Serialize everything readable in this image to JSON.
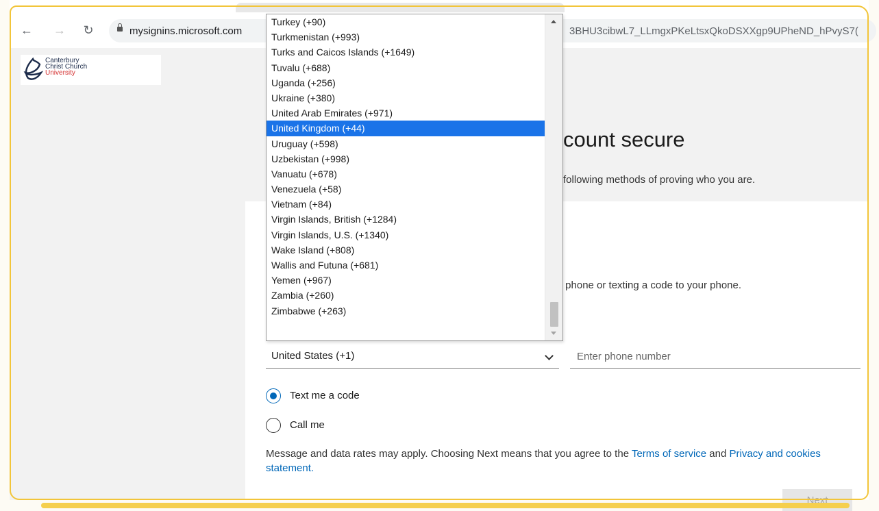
{
  "browser": {
    "url_host": "mysignins.microsoft.com",
    "url_tail": "3BHU3cibwL7_LLmgxPKeLtsxQkoDSXXgp9UPheND_hPvyS7("
  },
  "logo": {
    "line1": "Canterbury",
    "line2": "Christ Church",
    "line3": "University"
  },
  "page": {
    "title_partial": "count secure",
    "subtitle_partial": "following methods of proving who you are.",
    "method_desc_partial": "r phone or texting a code to your phone."
  },
  "form": {
    "country_selected": "United States (+1)",
    "phone_placeholder": "Enter phone number",
    "radio_text": "Text me a code",
    "radio_call": "Call me",
    "legal_prefix": "Message and data rates may apply. Choosing Next means that you agree to the ",
    "terms_link": "Terms of service",
    "legal_and": " and ",
    "privacy_link": "Privacy and cookies statement.",
    "next_label": "Next"
  },
  "dropdown": {
    "highlighted": "United Kingdom (+44)",
    "options": [
      "Turkey (+90)",
      "Turkmenistan (+993)",
      "Turks and Caicos Islands (+1649)",
      "Tuvalu (+688)",
      "Uganda (+256)",
      "Ukraine (+380)",
      "United Arab Emirates (+971)",
      "United Kingdom (+44)",
      "Uruguay (+598)",
      "Uzbekistan (+998)",
      "Vanuatu (+678)",
      "Venezuela (+58)",
      "Vietnam (+84)",
      "Virgin Islands, British (+1284)",
      "Virgin Islands, U.S. (+1340)",
      "Wake Island (+808)",
      "Wallis and Futuna (+681)",
      "Yemen (+967)",
      "Zambia (+260)",
      "Zimbabwe (+263)"
    ]
  },
  "icons": {
    "back": "back-arrow-icon",
    "forward": "forward-arrow-icon",
    "reload": "reload-icon",
    "lock": "lock-icon",
    "chevron": "chevron-down-icon"
  },
  "colors": {
    "accent": "#0067b8",
    "highlight": "#1a73e8",
    "frame": "#f2c53a"
  }
}
